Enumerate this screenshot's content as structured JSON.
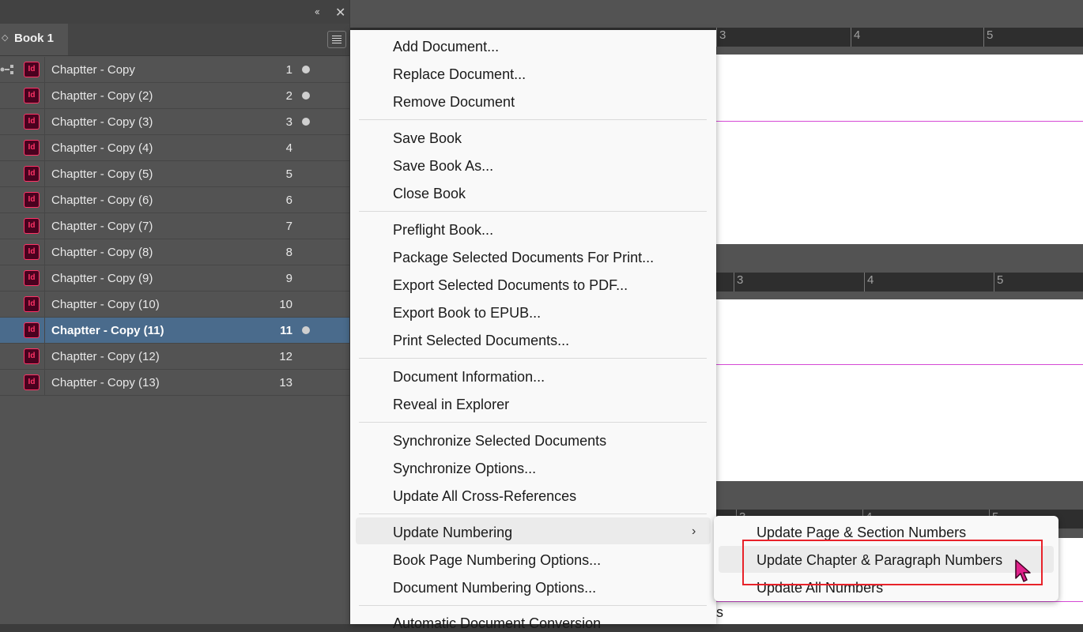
{
  "panel": {
    "tab_label": "Book 1",
    "documents": [
      {
        "name": "Chaptter - Copy",
        "number": "1",
        "open": true,
        "selected": false
      },
      {
        "name": "Chaptter - Copy (2)",
        "number": "2",
        "open": true,
        "selected": false
      },
      {
        "name": "Chaptter - Copy (3)",
        "number": "3",
        "open": true,
        "selected": false
      },
      {
        "name": "Chaptter - Copy (4)",
        "number": "4",
        "open": false,
        "selected": false
      },
      {
        "name": "Chaptter - Copy (5)",
        "number": "5",
        "open": false,
        "selected": false
      },
      {
        "name": "Chaptter - Copy (6)",
        "number": "6",
        "open": false,
        "selected": false
      },
      {
        "name": "Chaptter - Copy (7)",
        "number": "7",
        "open": false,
        "selected": false
      },
      {
        "name": "Chaptter - Copy (8)",
        "number": "8",
        "open": false,
        "selected": false
      },
      {
        "name": "Chaptter - Copy (9)",
        "number": "9",
        "open": false,
        "selected": false
      },
      {
        "name": "Chaptter - Copy (10)",
        "number": "10",
        "open": false,
        "selected": false
      },
      {
        "name": "Chaptter - Copy (11)",
        "number": "11",
        "open": true,
        "selected": true
      },
      {
        "name": "Chaptter - Copy (12)",
        "number": "12",
        "open": false,
        "selected": false
      },
      {
        "name": "Chaptter - Copy (13)",
        "number": "13",
        "open": false,
        "selected": false
      }
    ],
    "doc_icon_label": "Id",
    "collapse_glyph": "‹‹",
    "close_glyph": "✕",
    "tab_arrows_glyph": "◇"
  },
  "menu": {
    "groups": [
      [
        "Add Document...",
        "Replace Document...",
        "Remove Document"
      ],
      [
        "Save Book",
        "Save Book As...",
        "Close Book"
      ],
      [
        "Preflight Book...",
        "Package Selected Documents For Print...",
        "Export Selected Documents to PDF...",
        "Export Book to EPUB...",
        "Print Selected Documents..."
      ],
      [
        "Document Information...",
        "Reveal in Explorer"
      ],
      [
        "Synchronize Selected Documents",
        "Synchronize Options...",
        "Update All Cross-References"
      ],
      [
        "Update Numbering",
        "Book Page Numbering Options...",
        "Document Numbering Options..."
      ],
      [
        "Automatic Document Conversion"
      ]
    ],
    "submenu_arrow": "›"
  },
  "submenu": {
    "items": [
      "Update Page & Section Numbers",
      "Update Chapter & Paragraph Numbers",
      "Update All Numbers"
    ]
  },
  "rulers": [
    {
      "labels": [
        "3",
        "4",
        "5"
      ]
    },
    {
      "labels": [
        "3",
        "4",
        "5"
      ]
    },
    {
      "labels": [
        "3",
        "4",
        "5"
      ]
    }
  ],
  "colors": {
    "panel_bg": "#535353",
    "selected_row": "#4a6b8c",
    "indesign_icon": "#ff3366",
    "guide": "#d54ad5",
    "highlight_box": "#e8222a",
    "cursor": "#e0218a"
  },
  "bottom_text": "s"
}
